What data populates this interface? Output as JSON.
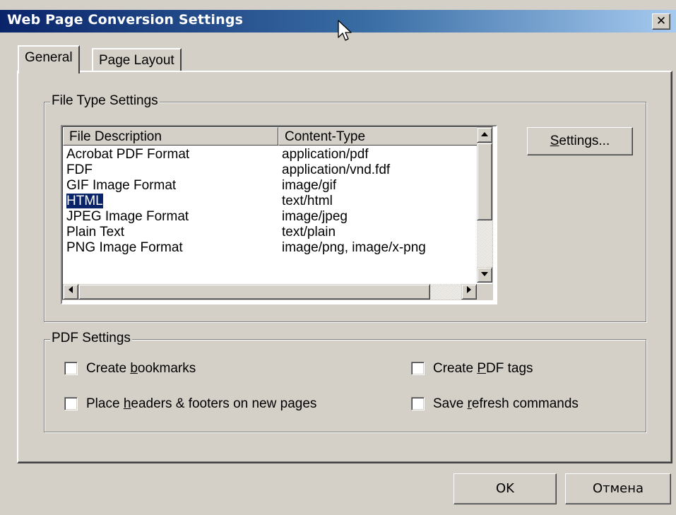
{
  "window": {
    "title": "Web Page Conversion Settings",
    "close_glyph": "✕"
  },
  "tabs": [
    {
      "label": "General",
      "active": true
    },
    {
      "label": "Page Layout",
      "active": false
    }
  ],
  "file_type_group": {
    "label": "File Type Settings",
    "columns": [
      "File Description",
      "Content-Type"
    ],
    "rows": [
      {
        "description": "Acrobat PDF Format",
        "content_type": "application/pdf",
        "selected": false
      },
      {
        "description": "FDF",
        "content_type": "application/vnd.fdf",
        "selected": false
      },
      {
        "description": "GIF Image Format",
        "content_type": "image/gif",
        "selected": false
      },
      {
        "description": "HTML",
        "content_type": "text/html",
        "selected": true
      },
      {
        "description": "JPEG Image Format",
        "content_type": "image/jpeg",
        "selected": false
      },
      {
        "description": "Plain Text",
        "content_type": "text/plain",
        "selected": false
      },
      {
        "description": "PNG Image Format",
        "content_type": "image/png, image/x-png",
        "selected": false
      }
    ],
    "settings_button": {
      "prefix": "",
      "mnemonic": "S",
      "rest": "ettings..."
    }
  },
  "pdf_group": {
    "label": "PDF Settings",
    "checkboxes": [
      {
        "pre": "Create ",
        "mnemonic": "b",
        "post": "ookmarks",
        "checked": false
      },
      {
        "pre": "Place ",
        "mnemonic": "h",
        "post": "eaders & footers on new pages",
        "checked": false
      },
      {
        "pre": "Create ",
        "mnemonic": "P",
        "post": "DF tags",
        "checked": false
      },
      {
        "pre": "Save ",
        "mnemonic": "r",
        "post": "efresh commands",
        "checked": false
      }
    ]
  },
  "buttons": {
    "ok": "OK",
    "cancel": "Отмена"
  },
  "colors": {
    "titlebar_start": "#0a246a",
    "titlebar_end": "#a6caf0",
    "face": "#d4d0c8",
    "selection": "#0a246a"
  },
  "icons": {
    "cursor": "arrow-cursor-icon",
    "close": "close-icon",
    "scroll_up": "arrow-up-icon",
    "scroll_down": "arrow-down-icon",
    "scroll_left": "arrow-left-icon",
    "scroll_right": "arrow-right-icon"
  }
}
